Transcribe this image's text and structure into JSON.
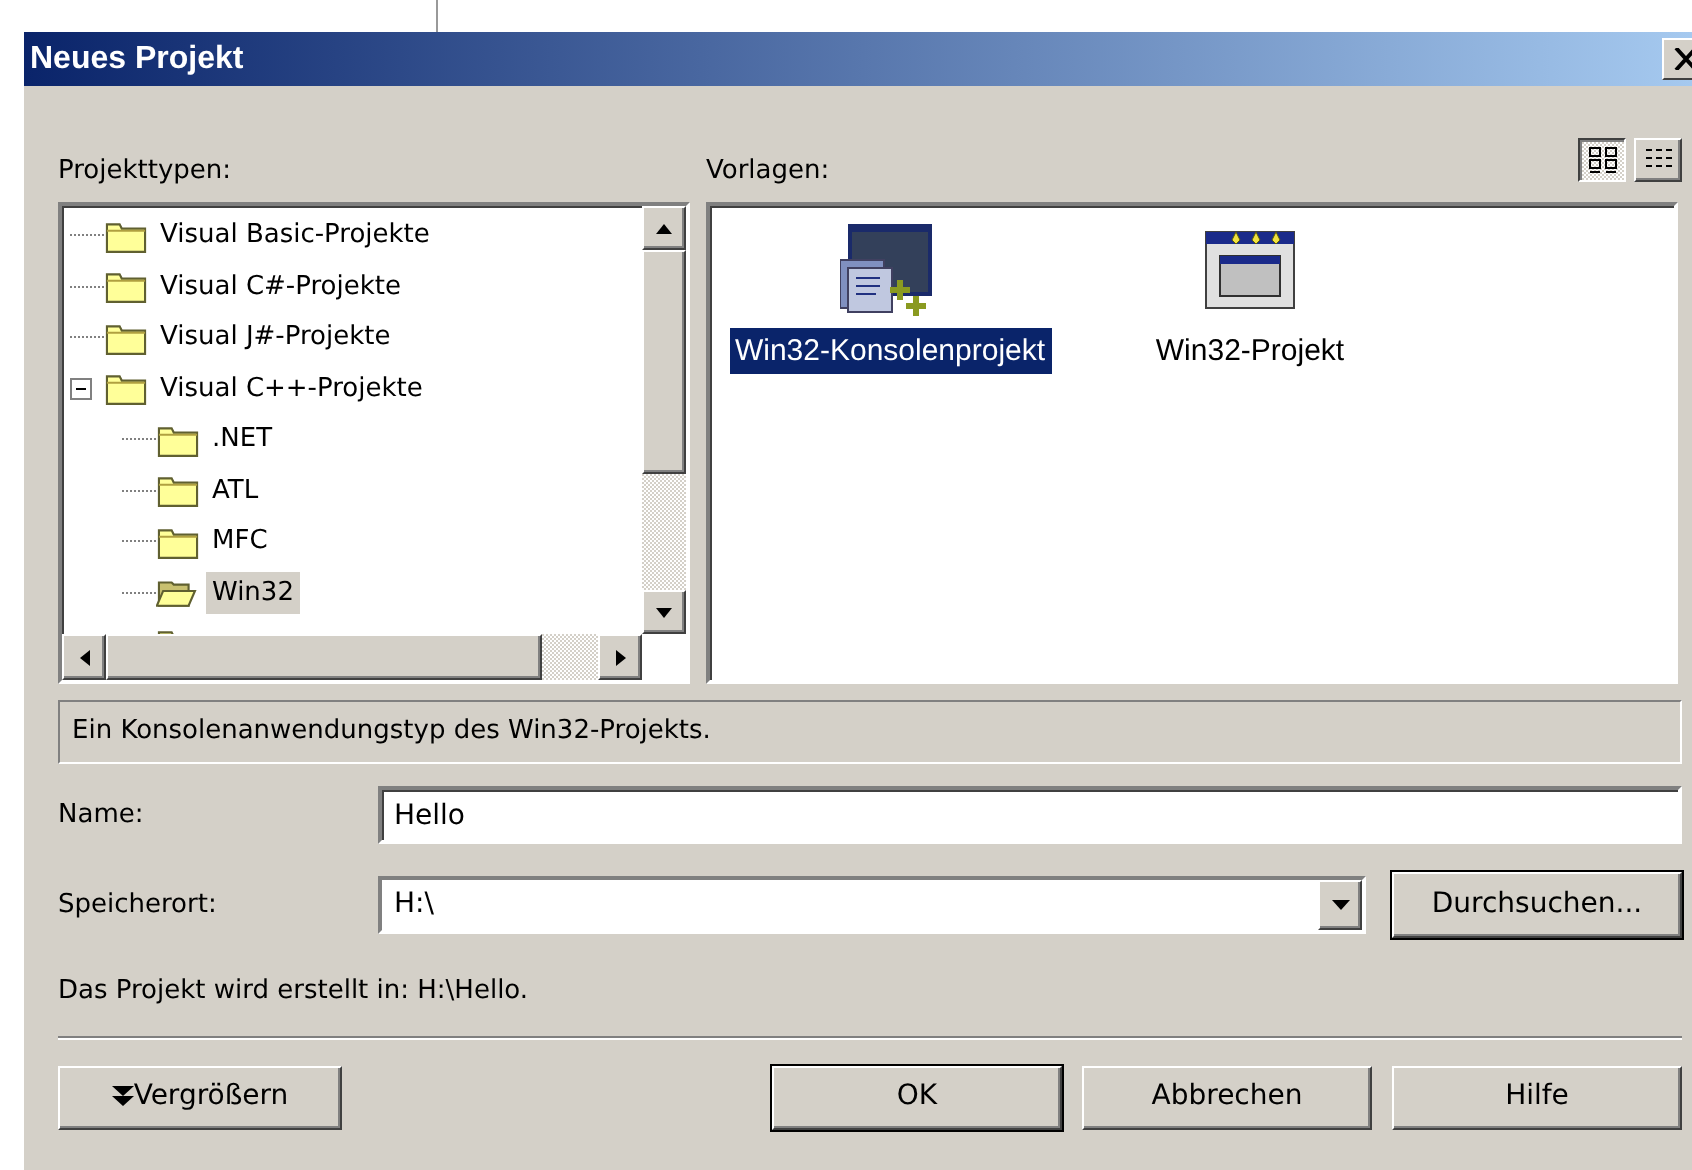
{
  "window": {
    "title": "Neues Projekt"
  },
  "project_types": {
    "label": "Projekttypen:",
    "tree": [
      {
        "label": "Visual Basic-Projekte",
        "selected": false
      },
      {
        "label": "Visual C#-Projekte",
        "selected": false
      },
      {
        "label": "Visual J#-Projekte",
        "selected": false
      },
      {
        "label": "Visual C++-Projekte",
        "selected": false,
        "expanded": true,
        "children": [
          {
            "label": ".NET",
            "selected": false
          },
          {
            "label": "ATL",
            "selected": false
          },
          {
            "label": "MFC",
            "selected": false
          },
          {
            "label": "Win32",
            "selected": true
          }
        ]
      }
    ]
  },
  "templates": {
    "label": "Vorlagen:",
    "view_buttons": [
      {
        "kind": "large-icons",
        "selected": true
      },
      {
        "kind": "small-icons",
        "selected": false
      }
    ],
    "items": [
      {
        "label": "Win32-Konsolenprojekt",
        "kind": "console",
        "selected": true
      },
      {
        "label": "Win32-Projekt",
        "kind": "window",
        "selected": false
      }
    ]
  },
  "description": "Ein Konsolenanwendungstyp des Win32-Projekts.",
  "name": {
    "label": "Name:",
    "value": "Hello"
  },
  "location": {
    "label": "Speicherort:",
    "value": "H:\\",
    "browse": "Durchsuchen..."
  },
  "path_note": "Das Projekt wird erstellt in: H:\\Hello.",
  "buttons": [
    {
      "label": "Vergrößern",
      "kind": "expand",
      "default": false
    },
    {
      "label": "OK",
      "kind": "plain",
      "default": true
    },
    {
      "label": "Abbrechen",
      "kind": "plain",
      "default": false
    },
    {
      "label": "Hilfe",
      "kind": "plain",
      "default": false
    }
  ]
}
